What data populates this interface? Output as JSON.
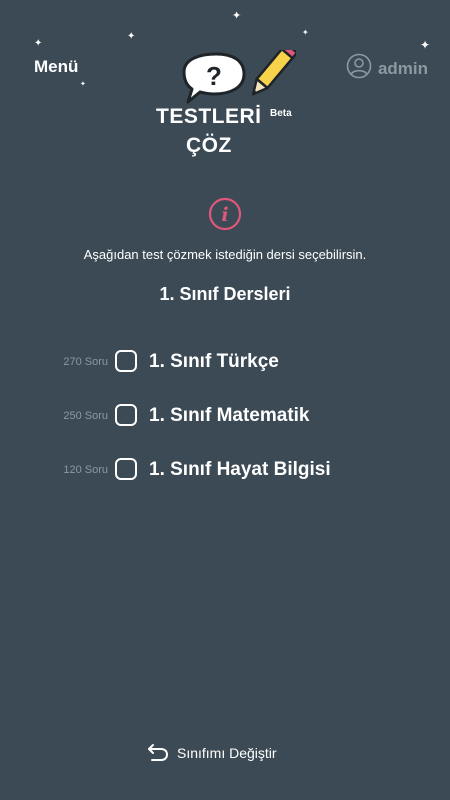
{
  "header": {
    "menu_label": "Menü",
    "user_name": "admin"
  },
  "logo": {
    "title": "TESTLERİ",
    "badge": "Beta",
    "subtitle": "ÇÖZ",
    "bubble_glyph": "?"
  },
  "icons": {
    "info": "info-circle-icon",
    "user": "user-circle-icon",
    "back": "undo-arrow-icon",
    "star": "sparkle-star-icon"
  },
  "colors": {
    "background": "#3b4a54",
    "accent_pink": "#e0577c",
    "muted_text": "#8d99a1",
    "pencil_yellow": "#f6d34a"
  },
  "main": {
    "instruction": "Aşağıdan test çözmek istediğin dersi seçebilirsin.",
    "section_title": "1. Sınıf Dersleri",
    "courses": [
      {
        "count": "270 Soru",
        "label": "1. Sınıf Türkçe",
        "selected": false
      },
      {
        "count": "250 Soru",
        "label": "1. Sınıf Matematik",
        "selected": false
      },
      {
        "count": "120 Soru",
        "label": "1. Sınıf Hayat Bilgisi",
        "selected": false
      }
    ]
  },
  "footer": {
    "change_class_label": "Sınıfımı Değiştir"
  }
}
